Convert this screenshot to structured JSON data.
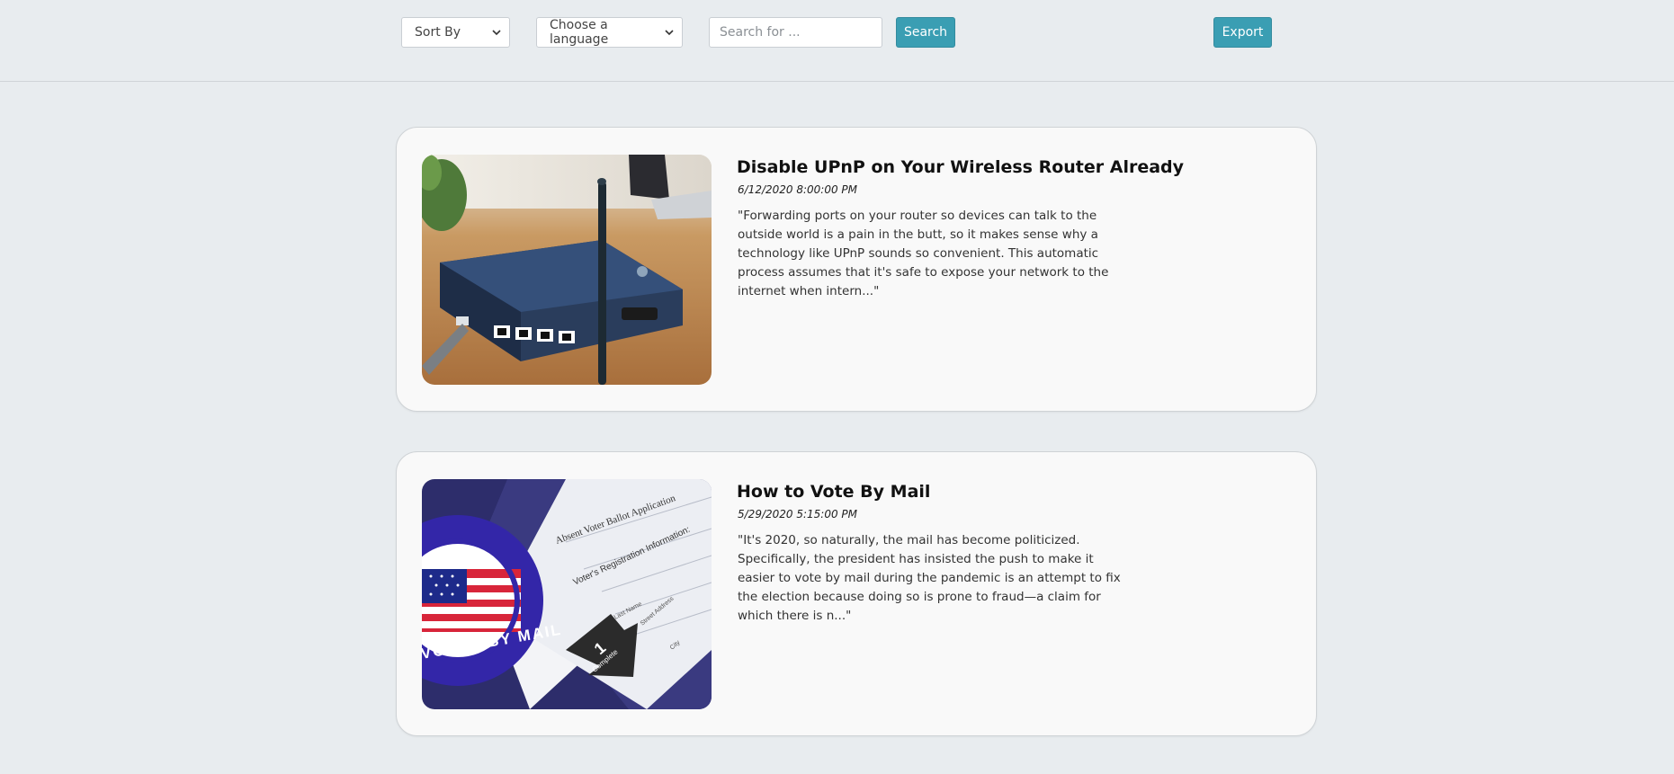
{
  "toolbar": {
    "sort_label": "Sort By",
    "language_label": "Choose a language",
    "search_placeholder": "Search for ...",
    "search_button": "Search",
    "export_button": "Export"
  },
  "articles": [
    {
      "title": "Disable UPnP on Your Wireless Router Already",
      "date": "6/12/2020 8:00:00 PM",
      "snippet": "\"Forwarding ports on your router so devices can talk to the outside world is a pain in the butt, so it makes sense why a technology like UPnP sounds so convenient. This automatic process assumes that it's safe to expose your network to the internet when intern...\""
    },
    {
      "title": "How to Vote By Mail",
      "date": "5/29/2020 5:15:00 PM",
      "snippet": "\"It's 2020, so naturally, the mail has become politicized. Specifically, the president has insisted the push to make it easier to vote by mail during the pandemic is an attempt to fix the election because doing so is prone to fraud—a claim for which there is n...\"",
      "image_text": {
        "form_title": "Absent Voter Ballot Application",
        "section": "Voter's Registration Information:",
        "field_last_name": "Last Name",
        "field_street": "Street Address",
        "field_city": "City",
        "step_number": "1",
        "step_label": "Complete",
        "sticker_text": "VOTED BY MAIL"
      }
    }
  ]
}
